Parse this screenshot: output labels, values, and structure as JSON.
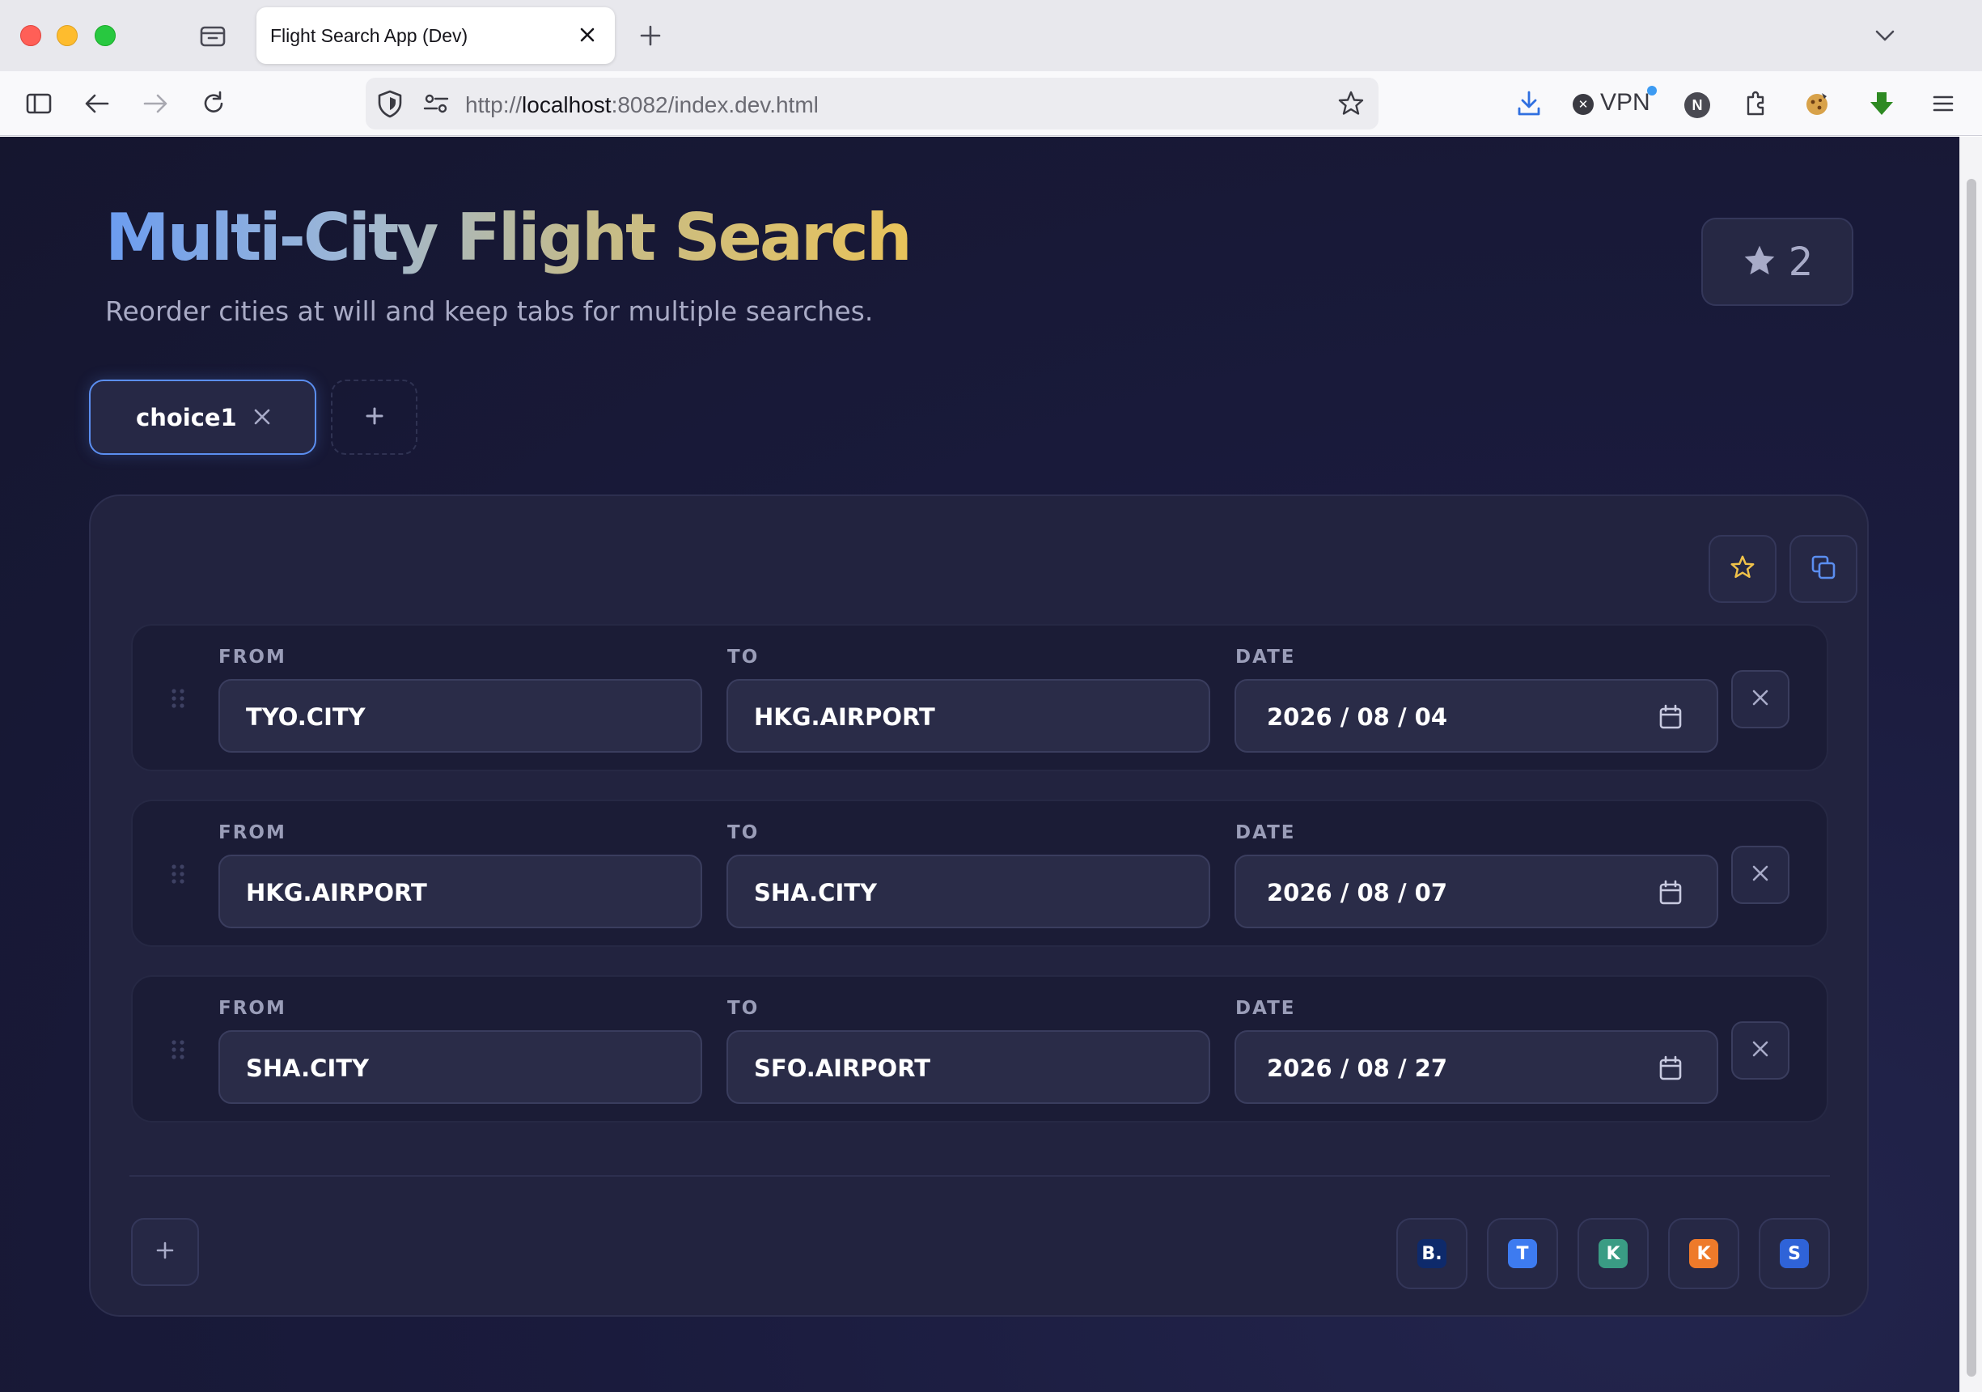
{
  "browser": {
    "tab_title": "Flight Search App (Dev)",
    "url_scheme": "http://",
    "url_host": "localhost",
    "url_rest": ":8082/index.dev.html",
    "vpn_label": "VPN",
    "profile_initial": "N"
  },
  "header": {
    "title": "Multi-City Flight Search",
    "subtitle": "Reorder cities at will and keep tabs for multiple searches.",
    "favorites_count": "2"
  },
  "tabs": [
    {
      "label": "choice1",
      "active": true
    }
  ],
  "legs": [
    {
      "from_label": "FROM",
      "from": "TYO.CITY",
      "to_label": "TO",
      "to": "HKG.AIRPORT",
      "date_label": "DATE",
      "date": "2026 / 08 / 04"
    },
    {
      "from_label": "FROM",
      "from": "HKG.AIRPORT",
      "to_label": "TO",
      "to": "SHA.CITY",
      "date_label": "DATE",
      "date": "2026 / 08 / 07"
    },
    {
      "from_label": "FROM",
      "from": "SHA.CITY",
      "to_label": "TO",
      "to": "SFO.AIRPORT",
      "date_label": "DATE",
      "date": "2026 / 08 / 27"
    }
  ],
  "providers": [
    {
      "letter": "B.",
      "color": "#0e2a6b"
    },
    {
      "letter": "T",
      "color": "#3d7bf0"
    },
    {
      "letter": "K",
      "color": "#3a9c84"
    },
    {
      "letter": "K",
      "color": "#ee7a2a"
    },
    {
      "letter": "S",
      "color": "#2f63d8"
    }
  ],
  "colors": {
    "accent": "#5b8ef0",
    "star_accent": "#f0c24a",
    "page_bg": "#1a1b3d",
    "panel_bg": "#22233f"
  },
  "icons": [
    "sidebar-icon",
    "back-icon",
    "forward-icon",
    "reload-icon",
    "shield-icon",
    "permissions-icon",
    "bookmark-star-icon",
    "download-icon",
    "extensions-icon",
    "menu-icon",
    "star-icon",
    "copy-icon",
    "drag-handle-icon",
    "calendar-icon",
    "close-icon",
    "plus-icon"
  ]
}
